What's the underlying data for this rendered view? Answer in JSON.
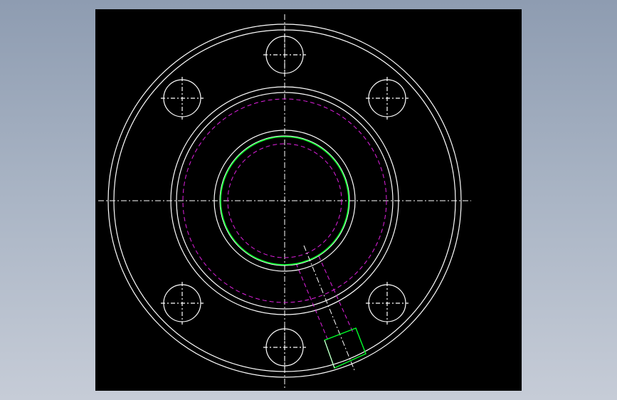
{
  "viewport": {
    "background": "#000000",
    "page_background_top": "#8e9cb1",
    "page_background_bottom": "#c6ccd7"
  },
  "colors": {
    "outline": "#ffffff",
    "hidden_line": "#e020e0",
    "highlight": "#00ff2a",
    "centerline": "#ffffff"
  },
  "drawing": {
    "view": "flange-front-view",
    "bolt_hole_count": 6,
    "features": [
      "outer-flange-circle",
      "bolt-circle-holes",
      "raised-face-circles",
      "hidden-bolt-pitch-circle",
      "bore-circles",
      "highlighted-bore-edge",
      "angled-port-passage"
    ]
  }
}
